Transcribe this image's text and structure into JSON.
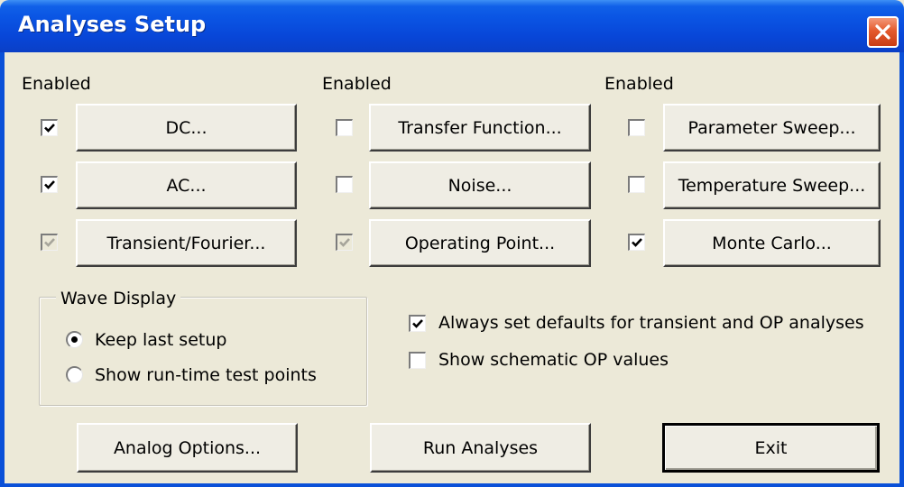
{
  "window": {
    "title": "Analyses Setup"
  },
  "columns": [
    {
      "header": "Enabled",
      "items": [
        {
          "label": "DC...",
          "checked": true,
          "disabled": false
        },
        {
          "label": "AC...",
          "checked": true,
          "disabled": false
        },
        {
          "label": "Transient/Fourier...",
          "checked": true,
          "disabled": true
        }
      ]
    },
    {
      "header": "Enabled",
      "items": [
        {
          "label": "Transfer Function...",
          "checked": false,
          "disabled": false
        },
        {
          "label": "Noise...",
          "checked": false,
          "disabled": false
        },
        {
          "label": "Operating Point...",
          "checked": true,
          "disabled": true
        }
      ]
    },
    {
      "header": "Enabled",
      "items": [
        {
          "label": "Parameter Sweep...",
          "checked": false,
          "disabled": false
        },
        {
          "label": "Temperature Sweep...",
          "checked": false,
          "disabled": false
        },
        {
          "label": "Monte Carlo...",
          "checked": true,
          "disabled": false
        }
      ]
    }
  ],
  "wave_display": {
    "title": "Wave Display",
    "options": [
      {
        "label": "Keep last setup",
        "selected": true
      },
      {
        "label": "Show run-time test points",
        "selected": false
      }
    ]
  },
  "options": [
    {
      "label": "Always set defaults for transient and OP analyses",
      "checked": true
    },
    {
      "label": "Show schematic OP values",
      "checked": false
    }
  ],
  "footer": {
    "analog_options_label": "Analog Options...",
    "run_analyses_label": "Run Analyses",
    "exit_label": "Exit"
  },
  "colors": {
    "titlebar": "#0a54e3",
    "dialog_bg": "#ece9d8",
    "close_button": "#e45a2d"
  }
}
